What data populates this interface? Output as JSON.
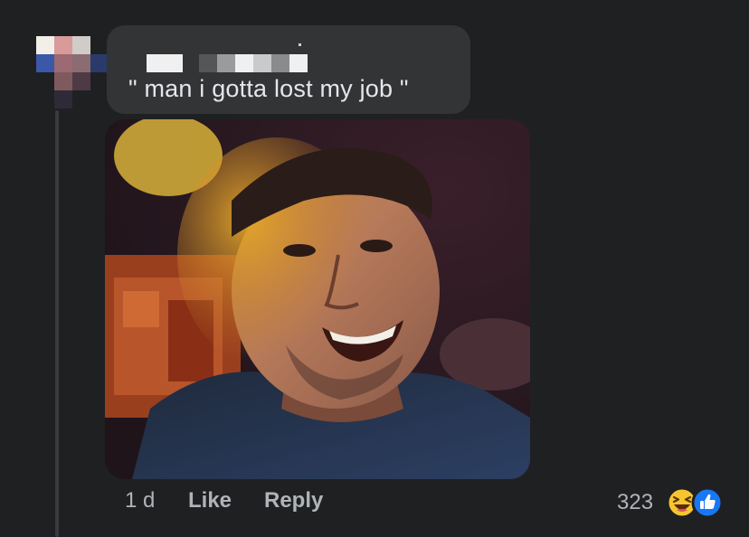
{
  "comment": {
    "author_name": "",
    "text": "\" man i gotta lost my job \"",
    "media_alt": "man smiling with yellow powder on face",
    "time": "1 d",
    "like_label": "Like",
    "reply_label": "Reply",
    "reaction_count": "323",
    "reactions": [
      "haha-icon",
      "like-icon"
    ]
  },
  "colors": {
    "background": "#1f2022",
    "bubble": "#333436",
    "text": "#e4e6eb",
    "secondary_text": "#b0b3b8",
    "like_blue": "#1877f2",
    "haha_yellow": "#f7c531"
  }
}
